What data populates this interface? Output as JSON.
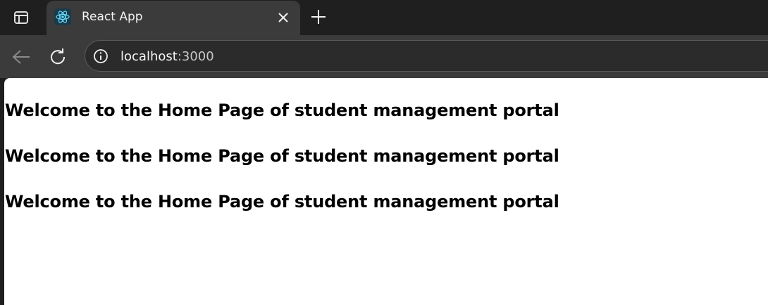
{
  "browser": {
    "tab": {
      "title": "React App",
      "favicon": "react-logo-icon"
    },
    "address_bar": {
      "host": "localhost",
      "port": ":3000",
      "site_info_icon": "info-icon"
    },
    "icons": {
      "sidebar_toggle": "sidebar-toggle-icon",
      "close_tab": "close-icon",
      "new_tab": "plus-icon",
      "back": "arrow-left-icon",
      "reload": "reload-icon"
    },
    "colors": {
      "tab_bar": "#1f1f1f",
      "toolbar": "#3b3b3b",
      "react_blue": "#61dafb"
    }
  },
  "page": {
    "headings": [
      "Welcome to the Home Page of student management portal",
      "Welcome to the Home Page of student management portal",
      "Welcome to the Home Page of student management portal"
    ]
  }
}
